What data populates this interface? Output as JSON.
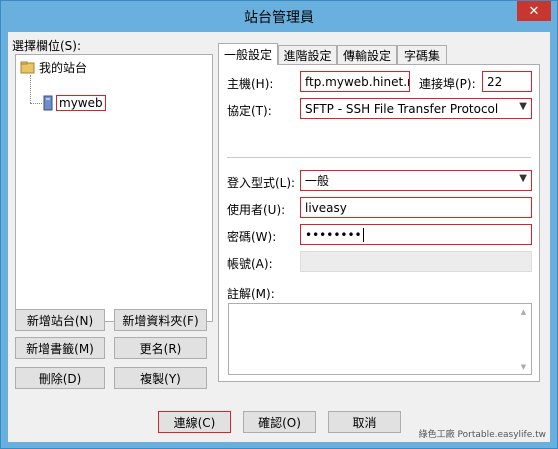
{
  "window": {
    "title": "站台管理員",
    "close_glyph": "✕"
  },
  "sidebar": {
    "label": "選擇欄位(S):",
    "tree_root": "我的站台",
    "tree_site": "myweb",
    "buttons": {
      "new_site": "新增站台(N)",
      "new_folder": "新增資料夾(F)",
      "new_bookmark": "新增書籤(M)",
      "rename": "更名(R)",
      "delete": "刪除(D)",
      "copy": "複製(Y)"
    }
  },
  "tabs": [
    "一般設定",
    "進階設定",
    "傳輸設定",
    "字碼集"
  ],
  "general": {
    "host_label": "主機(H):",
    "host_value": "ftp.myweb.hinet.net",
    "port_label": "連接埠(P):",
    "port_value": "22",
    "protocol_label": "協定(T):",
    "protocol_value": "SFTP - SSH File Transfer Protocol",
    "logon_label": "登入型式(L):",
    "logon_value": "一般",
    "user_label": "使用者(U):",
    "user_value": "liveasy",
    "password_label": "密碼(W):",
    "password_value": "••••••••",
    "account_label": "帳號(A):",
    "account_value": "",
    "comments_label": "註解(M):"
  },
  "footer": {
    "connect": "連線(C)",
    "ok": "確認(O)",
    "cancel": "取消",
    "watermark": "綠色工廠 Portable.easylife.tw"
  },
  "icons": {
    "root": "folder-network-icon",
    "site": "server-icon",
    "dropdown": "chevron-down-icon"
  },
  "colors": {
    "titlebar": "#6ab0de",
    "highlight": "#d9232a",
    "close": "#c7372f"
  }
}
